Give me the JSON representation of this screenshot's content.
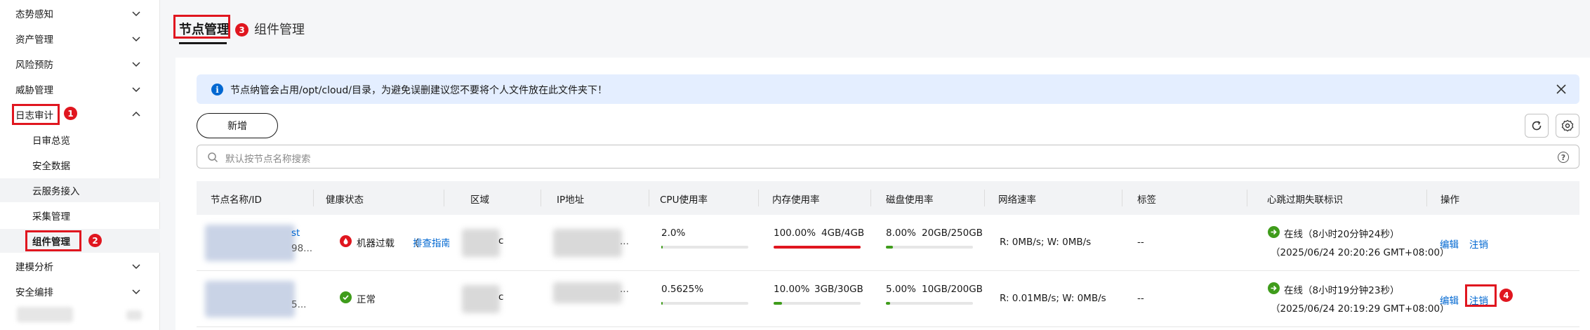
{
  "sidebar": {
    "items": [
      {
        "label": "态势感知",
        "chevron": "down"
      },
      {
        "label": "资产管理",
        "chevron": "down"
      },
      {
        "label": "风险预防",
        "chevron": "down"
      },
      {
        "label": "威胁管理",
        "chevron": "down"
      },
      {
        "label": "日志审计",
        "chevron": "up",
        "step": "1"
      },
      {
        "label": "日审总览"
      },
      {
        "label": "安全数据"
      },
      {
        "label": "云服务接入"
      },
      {
        "label": "采集管理"
      },
      {
        "label": "组件管理",
        "step": "2"
      },
      {
        "label": "建模分析",
        "chevron": "down"
      },
      {
        "label": "安全编排",
        "chevron": "down"
      }
    ]
  },
  "tabs": [
    {
      "label": "节点管理",
      "step": "3"
    },
    {
      "label": "组件管理"
    }
  ],
  "alert": {
    "text": "节点纳管会占用/opt/cloud/目录，为避免误删建议您不要将个人文件放在此文件夹下！"
  },
  "toolbar": {
    "add_label": "新增"
  },
  "search": {
    "placeholder": "默认按节点名称搜索"
  },
  "table": {
    "columns": [
      "节点名称/ID",
      "健康状态",
      "区域",
      "IP地址",
      "CPU使用率",
      "内存使用率",
      "磁盘使用率",
      "网络速率",
      "标签",
      "心跳过期失联标识",
      "操作"
    ],
    "rows": [
      {
        "name_suffix": "st",
        "id_suffix": "98...",
        "region_suffix": "c",
        "ip_suffix": "...",
        "health": "机器过载",
        "health_paren": "（",
        "health_link": "排查指南",
        "health_color": "#e0161f",
        "cpu": "2.0%",
        "cpu_level": 0.02,
        "mem": "100.00%",
        "mem_size": "4GB/4GB",
        "mem_level": 1.0,
        "disk": "8.00%",
        "disk_size": "20GB/250GB",
        "disk_level": 0.08,
        "net": "R: 0MB/s; W: 0MB/s",
        "tag": "--",
        "heartbeat": "在线（8小时20分钟24秒）",
        "heartbeat_time": "（2025/06/24 20:20:26 GMT+08:00）",
        "edit": "编辑",
        "deregister": "注销"
      },
      {
        "name_suffix": "",
        "id_suffix": "5...",
        "region_suffix": "c",
        "ip_suffix": "...",
        "health": "正常",
        "health_color": "#3f9c1b",
        "cpu": "0.5625%",
        "cpu_level": 0.005625,
        "mem": "10.00%",
        "mem_size": "3GB/30GB",
        "mem_level": 0.1,
        "disk": "5.00%",
        "disk_size": "10GB/200GB",
        "disk_level": 0.05,
        "net": "R: 0.01MB/s; W: 0MB/s",
        "tag": "--",
        "heartbeat": "在线（8小时19分钟23秒）",
        "heartbeat_time": "（2025/06/24 20:19:29 GMT+08:00）",
        "edit": "编辑",
        "deregister": "注销",
        "step": "4"
      }
    ]
  },
  "colors": {
    "accent": "#0067d1",
    "danger": "#e0161f",
    "success": "#3f9c1b",
    "alert_bg": "#e4eeff"
  }
}
